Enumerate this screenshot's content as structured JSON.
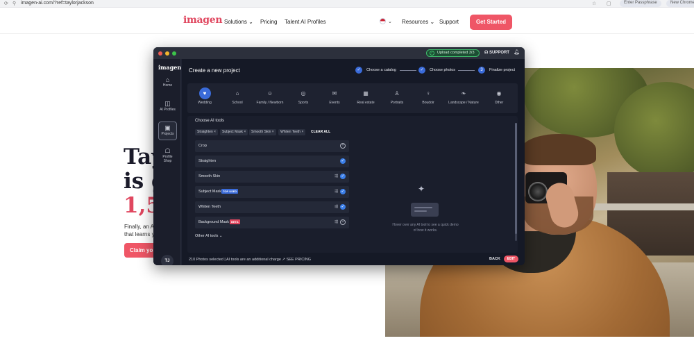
{
  "browser": {
    "url": "imagen-ai.com/?ref=taylorjackson",
    "profile_pill": "Enter Passphrase",
    "new_chrome_pill": "New Chrome"
  },
  "site": {
    "logo": "imagen",
    "nav": {
      "solutions": "Solutions ⌄",
      "pricing": "Pricing",
      "talent": "Talent AI Profiles",
      "resources": "Resources ⌄",
      "support": "Support",
      "get_started": "Get Started"
    },
    "hero": {
      "line1": "Tay",
      "line2": "is g",
      "line3": "1,5",
      "sub1": "Finally, an A",
      "sub2": "that learns y",
      "claim": "Claim yo"
    }
  },
  "app": {
    "upload_status": "Upload completed 3/3",
    "support": "SUPPORT",
    "sidebar": {
      "logo": "imagen",
      "items": [
        {
          "label": "Home",
          "icon": "home-icon",
          "glyph": "⌂"
        },
        {
          "label": "AI Profiles",
          "icon": "profile-icon",
          "glyph": "◫"
        },
        {
          "label": "Projects",
          "icon": "projects-icon",
          "glyph": "▣"
        },
        {
          "label": "Profile Shop",
          "icon": "shop-icon",
          "glyph": "☖"
        }
      ],
      "avatar": "TJ"
    },
    "title": "Create a new project",
    "steps": [
      {
        "label": "Choose a catalog",
        "marker": "✓"
      },
      {
        "label": "Choose photos",
        "marker": "✓"
      },
      {
        "label": "Finalize project",
        "marker": "3"
      }
    ],
    "categories": [
      {
        "label": "Wedding",
        "glyph": "♥",
        "active": true
      },
      {
        "label": "School",
        "glyph": "⌂",
        "active": false
      },
      {
        "label": "Family / Newborn",
        "glyph": "☺",
        "active": false
      },
      {
        "label": "Sports",
        "glyph": "◎",
        "active": false
      },
      {
        "label": "Events",
        "glyph": "✉",
        "active": false
      },
      {
        "label": "Real estate",
        "glyph": "▦",
        "active": false
      },
      {
        "label": "Portraits",
        "glyph": "♙",
        "active": false
      },
      {
        "label": "Boudoir",
        "glyph": "♀",
        "active": false
      },
      {
        "label": "Landscape / Nature",
        "glyph": "❧",
        "active": false
      },
      {
        "label": "Other",
        "glyph": "◉",
        "active": false
      }
    ],
    "choose_ai_tools": "Choose AI tools",
    "chips": [
      "Straighten ×",
      "Subject Mask ×",
      "Smooth Skin ×",
      "Whiten Teeth ×"
    ],
    "clear_all": "CLEAR ALL",
    "tools": [
      {
        "name": "Crop",
        "badge": "",
        "selected": false,
        "state": "+"
      },
      {
        "name": "Straighten",
        "badge": "",
        "selected": true,
        "state": "✓"
      },
      {
        "name": "Smooth Skin",
        "badge": "",
        "selected": true,
        "state": "✓"
      },
      {
        "name": "Subject Mask",
        "badge": "TOP USED",
        "badge_color": "#3a6bd9",
        "selected": true,
        "state": "✓"
      },
      {
        "name": "Whiten Teeth",
        "badge": "",
        "selected": true,
        "state": "✓"
      },
      {
        "name": "Background Mask",
        "badge": "BETA",
        "badge_color": "#e0475f",
        "selected": false,
        "state": "+"
      }
    ],
    "other_tools": "Other AI tools ⌄",
    "hover_hint": "Hover over any AI tool to see a quick demo of how it works.",
    "footer": {
      "summary": "210 Photos selected  |  AI tools are an additional charge  ↗ SEE PRICING",
      "back": "BACK",
      "edit": "EDIT"
    }
  },
  "colors": {
    "brand": "#e0475f",
    "accent": "#3a6bd9",
    "success": "#3fbf6c"
  }
}
